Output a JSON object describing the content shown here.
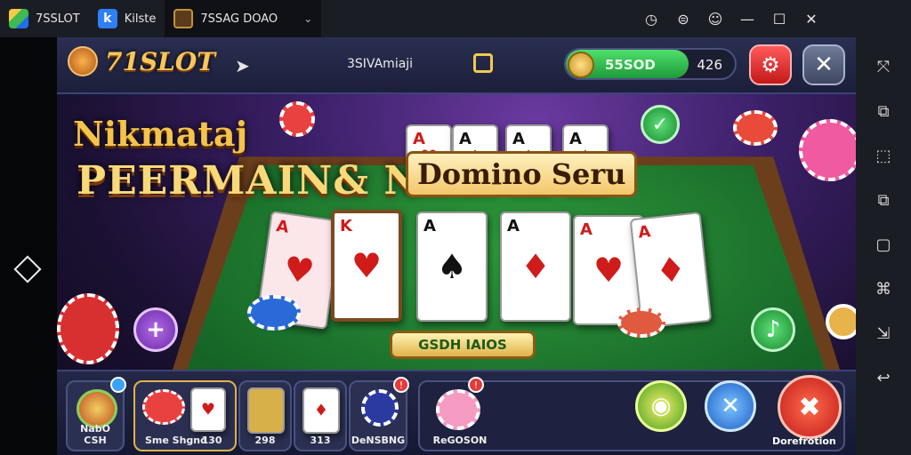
{
  "emulator": {
    "tabs": [
      {
        "label": "7SSLOT",
        "icon": "app-stack-icon"
      },
      {
        "label": "Kilste",
        "icon": "app-k-icon"
      },
      {
        "label": "7SSAG DOAO",
        "icon": "game-thumb-icon",
        "caret": "⌄"
      }
    ],
    "controls": [
      "◷",
      "⊜",
      "☺",
      "—",
      "☐",
      "✕"
    ],
    "sidebar_icons": [
      "⤧",
      "⧉",
      "⬚",
      "⧉",
      "▢",
      "⌘",
      "⇲",
      "↩"
    ]
  },
  "header": {
    "brand": "71SLOT",
    "user": "3SIVAmiaji",
    "balance_primary": "55SOD",
    "balance_secondary": "426",
    "gear_glyph": "⚙",
    "close_glyph": "✕"
  },
  "promo": {
    "line1": "Nikmataj",
    "line2": "PEERMAIN& N",
    "line3": "Domino Seru"
  },
  "table": {
    "top_cards": [
      {
        "rank": "A",
        "suit": "♥",
        "color": "red"
      },
      {
        "rank": "A",
        "suit": "♠",
        "color": "blk"
      },
      {
        "rank": "A",
        "suit": "♠",
        "color": "blk"
      },
      {
        "rank": "A",
        "suit": "♠",
        "color": "blk"
      }
    ],
    "hand_cards": [
      {
        "rank": "A",
        "suit": "♥",
        "color": "red"
      },
      {
        "rank": "K",
        "suit": "♥",
        "color": "red"
      },
      {
        "rank": "A",
        "suit": "♠",
        "color": "blk"
      },
      {
        "rank": "A",
        "suit": "♦",
        "color": "red"
      },
      {
        "rank": "A",
        "suit": "♥",
        "color": "red"
      },
      {
        "rank": "A",
        "suit": "♦",
        "color": "red"
      }
    ],
    "gold_button": "GSDH IAIOS",
    "plus_glyph": "+"
  },
  "bottom": {
    "slots": [
      {
        "label": "NabO CSH",
        "badge": ""
      },
      {
        "label": "Sme Shgnd",
        "label2": "130"
      },
      {
        "label": "298"
      },
      {
        "label": "313"
      },
      {
        "label": "DeNSBNG",
        "badge": "!"
      },
      {
        "label": "ReGOSON",
        "badge": "!"
      }
    ],
    "red_action_label": "Dorefrotion"
  }
}
